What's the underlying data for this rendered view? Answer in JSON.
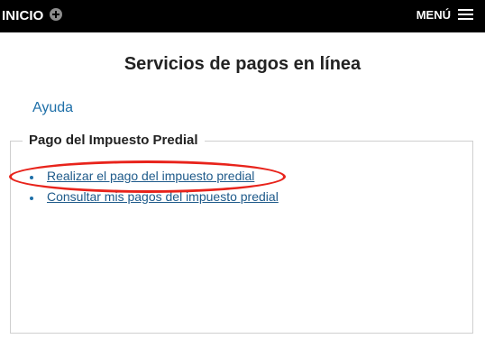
{
  "topbar": {
    "home_label": "INICIO",
    "home_icon": "plus-circle-icon",
    "menu_label": "MENÚ",
    "menu_icon": "hamburger-icon"
  },
  "main": {
    "title": "Servicios de pagos en línea",
    "help_link": "Ayuda",
    "section": {
      "legend": "Pago del Impuesto Predial",
      "links": [
        "Realizar el pago del impuesto predial",
        "Consultar mis pagos del impuesto predial"
      ]
    },
    "annotation_color": "#e8231b"
  }
}
